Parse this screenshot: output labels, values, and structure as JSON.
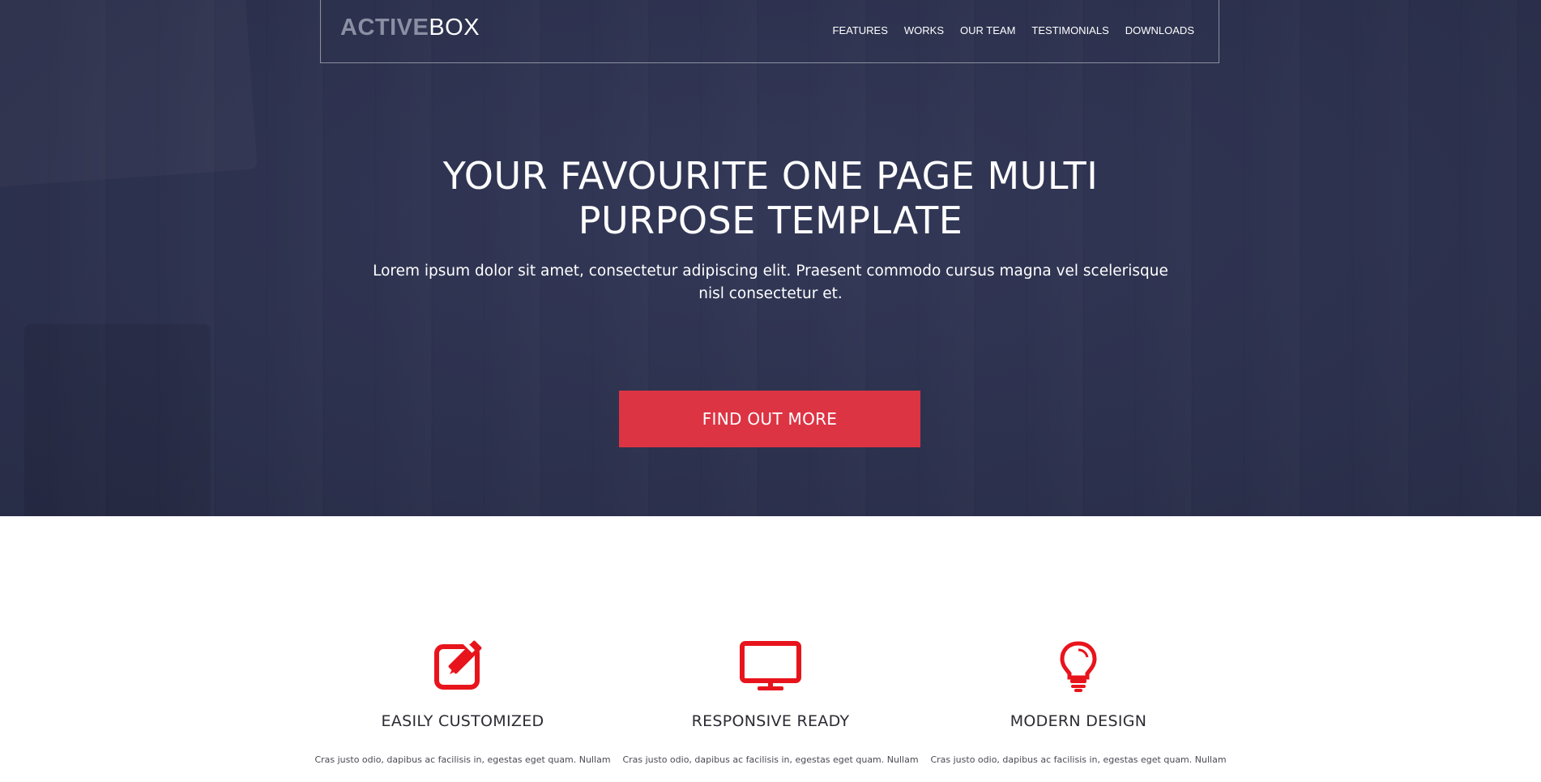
{
  "brand": {
    "logo_part1": "ACTIVE",
    "logo_part2": "BOX"
  },
  "nav": {
    "items": [
      "FEATURES",
      "WORKS",
      "OUR TEAM",
      "TESTIMONIALS",
      "DOWNLOADS"
    ]
  },
  "hero": {
    "title": "YOUR FAVOURITE ONE PAGE MULTI PURPOSE TEMPLATE",
    "subtitle": "Lorem ipsum dolor sit amet, consectetur adipiscing elit. Praesent commodo cursus magna vel scelerisque nisl consectetur et.",
    "cta_label": "FIND OUT MORE"
  },
  "colors": {
    "hero_bg": "#2f3452",
    "accent": "#dd3444",
    "icon": "#e8141c"
  },
  "features": [
    {
      "icon": "edit-pencil-icon",
      "title": "EASILY CUSTOMIZED",
      "text": "Cras justo odio, dapibus ac facilisis in, egestas eget quam. Nullam"
    },
    {
      "icon": "monitor-icon",
      "title": "RESPONSIVE READY",
      "text": "Cras justo odio, dapibus ac facilisis in, egestas eget quam. Nullam"
    },
    {
      "icon": "lightbulb-icon",
      "title": "MODERN DESIGN",
      "text": "Cras justo odio, dapibus ac facilisis in, egestas eget quam. Nullam"
    }
  ]
}
